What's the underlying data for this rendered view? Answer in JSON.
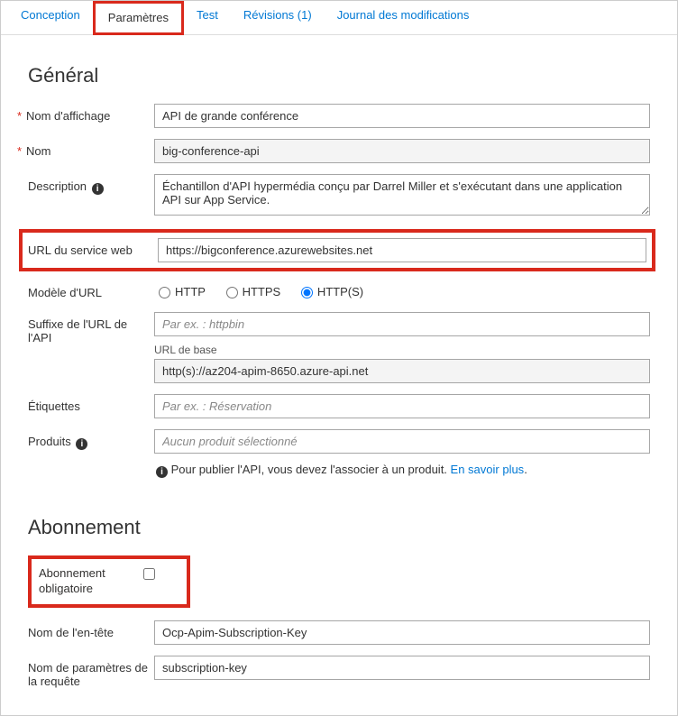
{
  "tabs": {
    "conception": "Conception",
    "parametres": "Paramètres",
    "test": "Test",
    "revisions": "Révisions (1)",
    "journal": "Journal des modifications"
  },
  "general": {
    "heading": "Général",
    "display_name_label": "Nom d'affichage",
    "display_name_value": "API de grande conférence",
    "name_label": "Nom",
    "name_value": "big-conference-api",
    "description_label": "Description",
    "description_value": "Échantillon d'API hypermédia conçu par Darrel Miller et s'exécutant dans une application API sur App Service.",
    "web_service_url_label": "URL du service web",
    "web_service_url_value": "https://bigconference.azurewebsites.net",
    "url_scheme_label": "Modèle d'URL",
    "scheme_http": "HTTP",
    "scheme_https": "HTTPS",
    "scheme_both": "HTTP(S)",
    "api_suffix_label": "Suffixe de l'URL de l'API",
    "api_suffix_placeholder": "Par ex. : httpbin",
    "base_url_label": "URL de base",
    "base_url_value": "http(s)://az204-apim-8650.azure-api.net",
    "tags_label": "Étiquettes",
    "tags_placeholder": "Par ex. : Réservation",
    "products_label": "Produits",
    "products_placeholder": "Aucun produit sélectionné",
    "products_note_text": "Pour publier l'API, vous devez l'associer à un produit. ",
    "products_note_link": "En savoir plus"
  },
  "subscription": {
    "heading": "Abonnement",
    "required_label": "Abonnement obligatoire",
    "header_name_label": "Nom de l'en-tête",
    "header_name_value": "Ocp-Apim-Subscription-Key",
    "query_param_label": "Nom de paramètres de la requête",
    "query_param_value": "subscription-key"
  }
}
